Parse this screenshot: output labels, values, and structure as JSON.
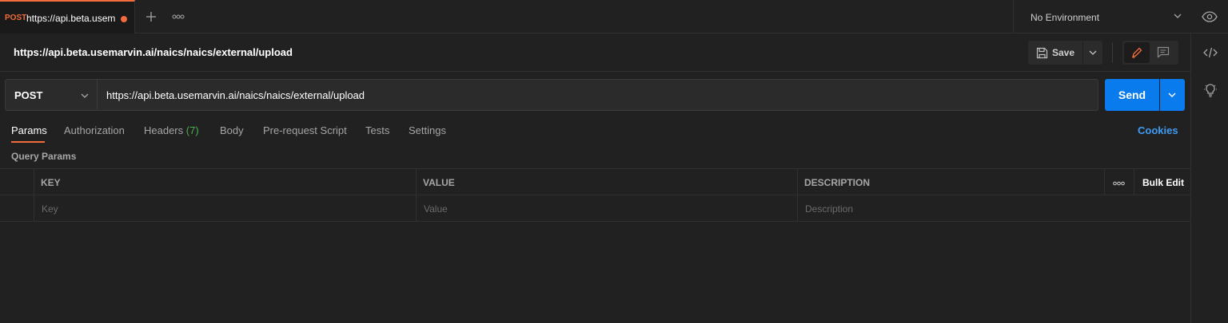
{
  "tab": {
    "method": "POST",
    "title": "https://api.beta.usem"
  },
  "environment": {
    "selected": "No Environment"
  },
  "request": {
    "title": "https://api.beta.usemarvin.ai/naics/naics/external/upload",
    "method": "POST",
    "url": "https://api.beta.usemarvin.ai/naics/naics/external/upload",
    "send_label": "Send",
    "save_label": "Save"
  },
  "request_tabs": {
    "params": "Params",
    "authorization": "Authorization",
    "headers": "Headers",
    "headers_count": "(7)",
    "body": "Body",
    "pre_request": "Pre-request Script",
    "tests": "Tests",
    "settings": "Settings",
    "cookies": "Cookies"
  },
  "query_params": {
    "title": "Query Params",
    "columns": {
      "key": "KEY",
      "value": "VALUE",
      "description": "DESCRIPTION",
      "bulk_edit": "Bulk Edit"
    },
    "placeholders": {
      "key": "Key",
      "value": "Value",
      "description": "Description"
    }
  },
  "colors": {
    "accent": "#f26b3a",
    "primary": "#097bed",
    "link": "#3f9cf5",
    "count": "#4caf50"
  }
}
